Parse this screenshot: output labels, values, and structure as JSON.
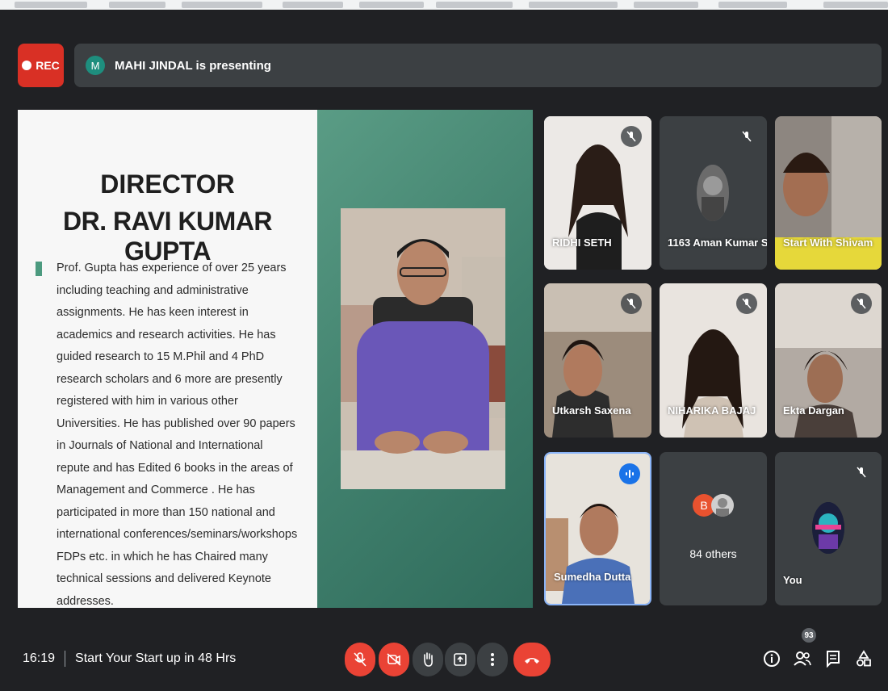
{
  "header": {
    "rec_label": "REC",
    "presenter_initial": "M",
    "presenting_text": "MAHI JINDAL is presenting"
  },
  "slide": {
    "title_line1": "DIRECTOR",
    "title_line2": "DR. RAVI KUMAR GUPTA",
    "bio": "Prof. Gupta has experience of over 25 years including teaching and administrative assignments. He has keen interest in academics and research activities. He has guided research to 15 M.Phil and 4 PhD research scholars and 6 more are presently registered with him in various other Universities. He has published over 90 papers in Journals of National and International repute and has Edited 6 books in the areas of Management and Commerce . He has participated in more than 150 national and international conferences/seminars/workshops FDPs etc. in which he has Chaired many technical sessions and delivered Keynote addresses."
  },
  "participants": [
    {
      "name": "RIDHI SETH",
      "muted": true
    },
    {
      "name": "1163 Aman Kumar S...",
      "muted": true
    },
    {
      "name": "Start With Shivam",
      "muted": false
    },
    {
      "name": "Utkarsh Saxena",
      "muted": true
    },
    {
      "name": "NIHARIKA BAJAJ",
      "muted": true
    },
    {
      "name": "Ekta Dargan",
      "muted": true
    },
    {
      "name": "Sumedha Dutta",
      "speaking": true
    },
    {
      "name": "84 others",
      "avatar_initial": "B"
    },
    {
      "name": "You",
      "muted": true
    }
  ],
  "footer": {
    "time": "16:19",
    "meeting_title": "Start Your Start up in 48 Hrs",
    "participant_count": "93"
  },
  "colors": {
    "accent_red": "#ea4335",
    "speaking_blue": "#1a73e8",
    "slide_green": "#4c9a7f"
  }
}
